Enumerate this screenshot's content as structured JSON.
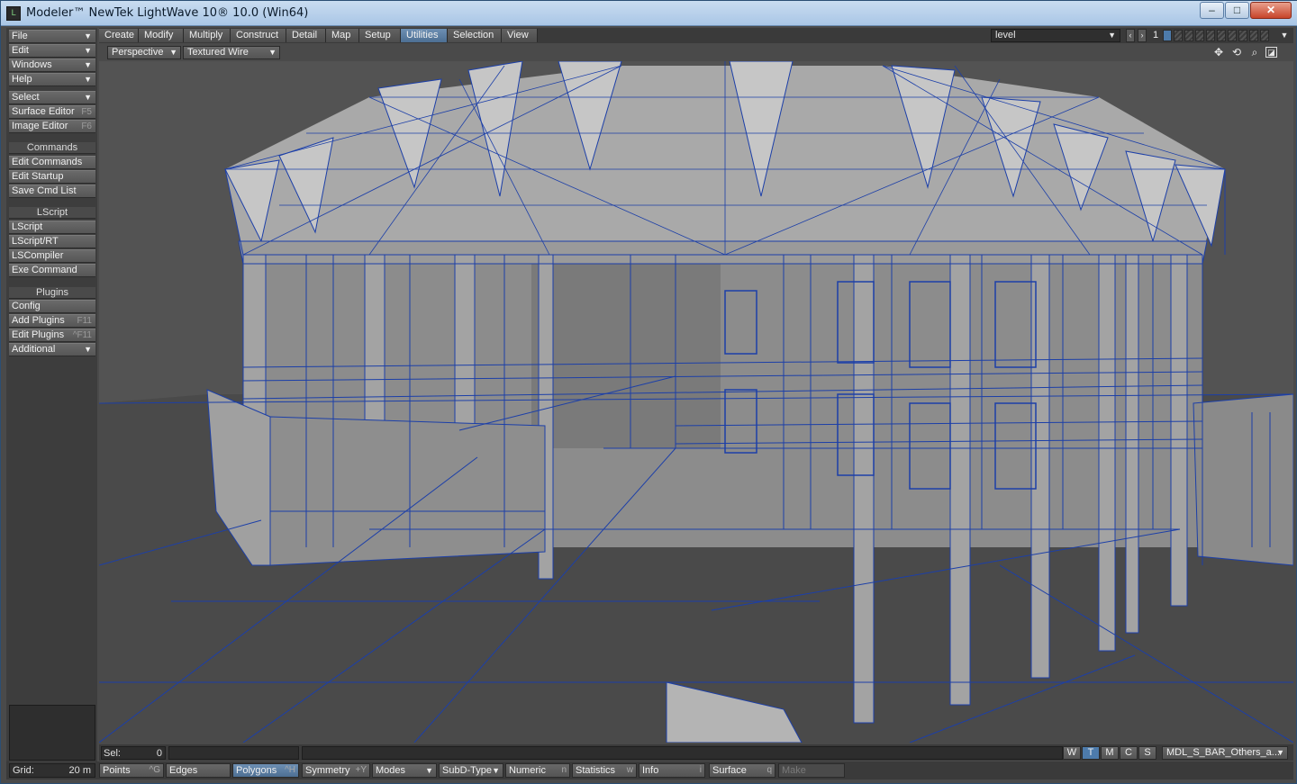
{
  "window": {
    "title": "Modeler™ NewTek LightWave 10® 10.0 (Win64)",
    "app_icon": "lightwave-icon",
    "controls": {
      "minimize": "‒",
      "maximize": "□",
      "close": "✕"
    }
  },
  "sidebar": {
    "items": [
      {
        "label": "File",
        "has_arrow": true
      },
      {
        "label": "Edit",
        "has_arrow": true
      },
      {
        "label": "Windows",
        "has_arrow": true
      },
      {
        "label": "Help",
        "has_arrow": true
      },
      {
        "label": "Select",
        "has_arrow": true
      },
      {
        "label": "Surface Editor",
        "shortcut": "F5"
      },
      {
        "label": "Image Editor",
        "shortcut": "F6"
      }
    ],
    "commands": {
      "header": "Commands",
      "items": [
        "Edit Commands",
        "Edit Startup",
        "Save Cmd List"
      ]
    },
    "lscript": {
      "header": "LScript",
      "items": [
        "LScript",
        "LScript/RT",
        "LSCompiler",
        "Exe Command"
      ]
    },
    "plugins": {
      "header": "Plugins",
      "items": [
        {
          "label": "Config"
        },
        {
          "label": "Add Plugins",
          "shortcut": "F11"
        },
        {
          "label": "Edit Plugins",
          "shortcut": "^F11"
        },
        {
          "label": "Additional",
          "has_arrow": true
        }
      ]
    }
  },
  "tabs": {
    "items": [
      "Create",
      "Modify",
      "Multiply",
      "Construct",
      "Detail",
      "Map",
      "Setup",
      "Utilities",
      "Selection",
      "View"
    ],
    "active": "Utilities"
  },
  "layer_bar": {
    "level_value": "level",
    "current_layer": "1"
  },
  "viewport": {
    "view_type": "Perspective",
    "render_mode": "Textured Wire",
    "tools": [
      "move-view-icon",
      "rotate-view-icon",
      "zoom-view-icon",
      "maximize-view-icon"
    ]
  },
  "status": {
    "sel_label": "Sel:",
    "sel_value": "0",
    "wtmcs": [
      "W",
      "T",
      "M",
      "C",
      "S"
    ],
    "wtmcs_active": "T",
    "surface": "MDL_S_BAR_Others_a..."
  },
  "bottom": {
    "grid_label": "Grid:",
    "grid_value": "20 m",
    "points": {
      "label": "Points",
      "shortcut": "^G"
    },
    "edges": {
      "label": "Edges"
    },
    "polygons": {
      "label": "Polygons",
      "shortcut": "^H"
    },
    "symmetry": {
      "label": "Symmetry",
      "shortcut": "+Y"
    },
    "modes": "Modes",
    "subd": "SubD-Type",
    "numeric": {
      "label": "Numeric",
      "shortcut": "n"
    },
    "statistics": {
      "label": "Statistics",
      "shortcut": "w"
    },
    "info": {
      "label": "Info",
      "shortcut": "i"
    },
    "surface": {
      "label": "Surface",
      "shortcut": "q"
    },
    "make": "Make"
  },
  "colors": {
    "wire": "#1c3fa8",
    "active_tab": "#4d6f93",
    "viewport_bg": "#535353"
  }
}
